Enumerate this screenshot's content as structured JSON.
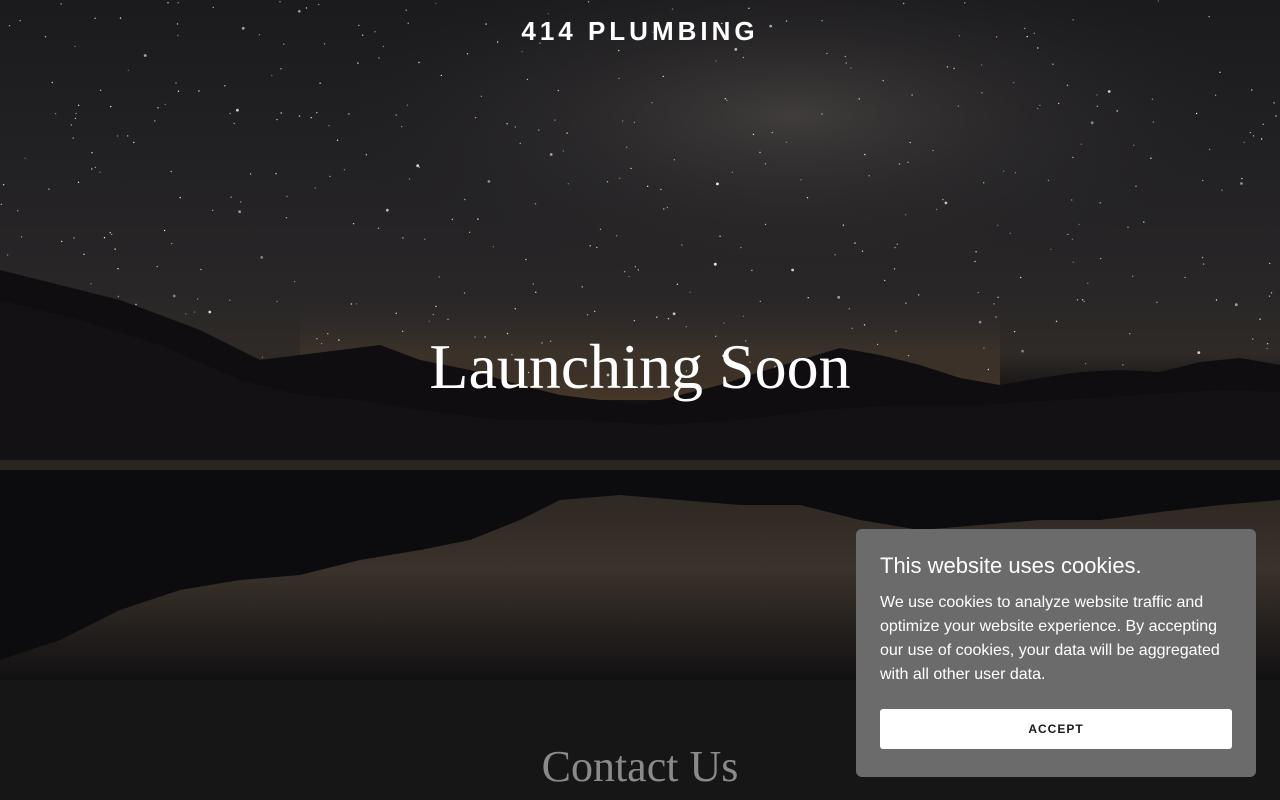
{
  "site": {
    "title": "414 PLUMBING"
  },
  "hero": {
    "headline": "Launching Soon"
  },
  "contact": {
    "title": "Contact Us"
  },
  "cookie_banner": {
    "title": "This website uses cookies.",
    "body": "We use cookies to analyze website traffic and optimize your website experience. By accepting our use of cookies, your data will be aggregated with all other user data.",
    "accept_label": "ACCEPT"
  },
  "colors": {
    "page_background": "#161616",
    "cookie_background": "#6b6b6b",
    "contact_title": "#8a8a8a",
    "button_background": "#ffffff"
  }
}
